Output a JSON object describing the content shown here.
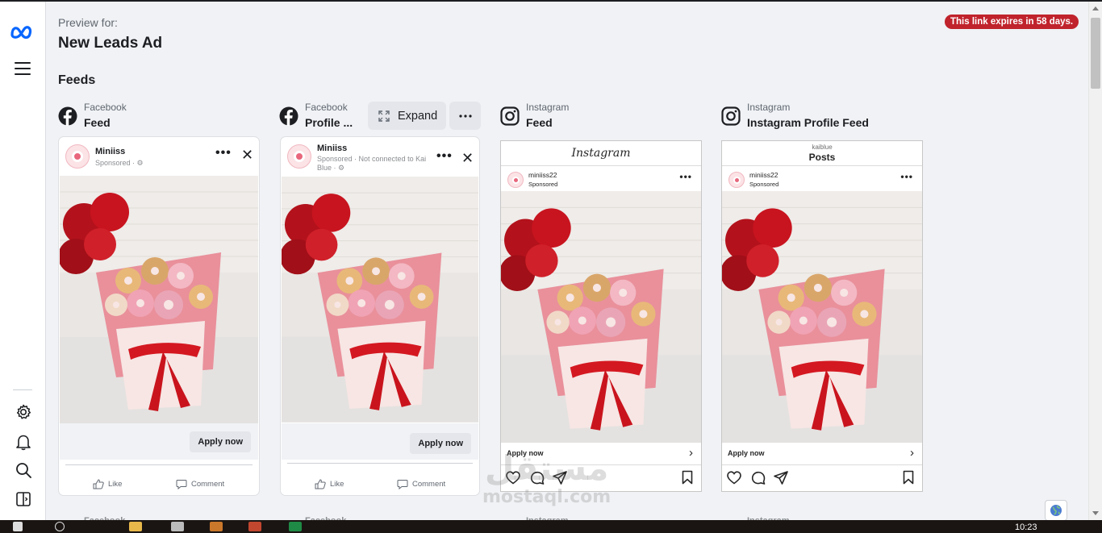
{
  "header": {
    "preview_for": "Preview for:",
    "ad_name": "New Leads Ad",
    "expiry_notice": "This link expires in 58 days.",
    "feeds_title": "Feeds"
  },
  "toolbar": {
    "expand_label": "Expand"
  },
  "columns": [
    {
      "platform": "Facebook",
      "placement": "Feed"
    },
    {
      "platform": "Facebook",
      "placement": "Profile ..."
    },
    {
      "platform": "Instagram",
      "placement": "Feed"
    },
    {
      "platform": "Instagram",
      "placement": "Instagram Profile Feed"
    }
  ],
  "fb_feed_card": {
    "page_name": "Miniiss",
    "sponsored": "Sponsored · ",
    "cta": "Apply now",
    "like": "Like",
    "comment": "Comment"
  },
  "fb_profile_card": {
    "page_name": "Miniiss",
    "sponsored": "Sponsored · Not connected to Kai Blue · ",
    "cta": "Apply now",
    "like": "Like",
    "comment": "Comment"
  },
  "ig_feed_card": {
    "top_wordmark": "Instagram",
    "handle": "miniiss22",
    "sponsored": "Sponsored",
    "cta": "Apply now"
  },
  "ig_profile_card": {
    "top_user": "kaiblue",
    "top_title": "Posts",
    "handle": "miniiss22",
    "sponsored": "Sponsored",
    "cta": "Apply now"
  },
  "bottom_peek": [
    "Facebook",
    "Facebook",
    "Instagram",
    "Instagram"
  ],
  "watermark": {
    "arabic": "مستقل",
    "latin": "mostaql.com"
  },
  "taskbar": {
    "clock": "10:23"
  },
  "colors": {
    "expiry_badge": "#c0232c",
    "meta_blue": "#0866ff",
    "page_bg": "#f0f2f5"
  },
  "icons": {
    "rail": [
      "meta-logo-icon",
      "hamburger-menu-icon",
      "settings-gear-icon",
      "bell-icon",
      "search-icon",
      "panel-toggle-icon"
    ],
    "platform": [
      "facebook-icon",
      "instagram-icon"
    ],
    "globe": "globe-icon"
  }
}
